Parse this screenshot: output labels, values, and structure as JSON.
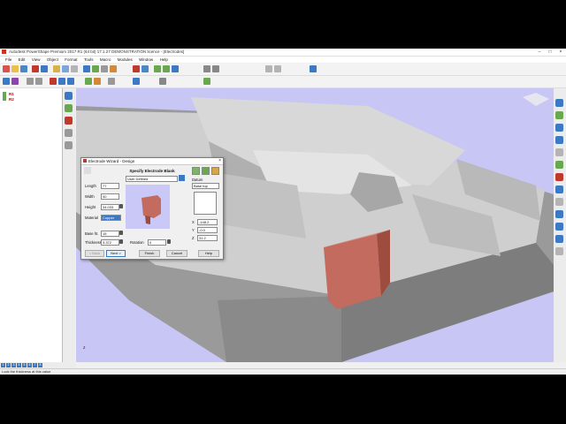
{
  "app": {
    "title": "Autodesk PowerShape Premium 2017 R1 (64 bit) 17.1.27 DEMONSTRATION licence - [Electrodes]",
    "window_controls": [
      "–",
      "□",
      "×"
    ]
  },
  "menu": [
    "File",
    "Edit",
    "View",
    "Object",
    "Format",
    "Tools",
    "Macro",
    "Modules",
    "Window",
    "Help"
  ],
  "tree": {
    "items": [
      "R1",
      "R2"
    ]
  },
  "dialog": {
    "title": "Electrode Wizard - Design",
    "close": "×",
    "heading": "Specify Electrode Blank",
    "length_label": "Length",
    "length_value": "77",
    "width_label": "Width",
    "width_value": "40",
    "height_label": "Height",
    "height_value": "34.033",
    "material_label": "Material",
    "material_value": "Copper",
    "base_label": "Base ht.",
    "base_value": "15",
    "thickness_label": "Thickness",
    "thickness_value": "3.372",
    "rotation_label": "Rotation",
    "rotation_value": "0",
    "type_value": "User Defined",
    "datum_label": "Datum",
    "datum_value": "Base top",
    "x_label": "X",
    "x_value": "-148.2",
    "y_label": "Y",
    "y_value": "-0.0",
    "z_label": "Z",
    "z_value": "31.2",
    "back": "< Back",
    "next": "Next >",
    "finish": "Finish",
    "cancel": "Cancel",
    "help": "Help"
  },
  "pages": [
    "1",
    "2",
    "3",
    "4",
    "5",
    "6",
    "7",
    "8"
  ],
  "status": "Lock the thickness at this value",
  "colors": {
    "viewport": "#c7c6f5",
    "electrode": "#c36b5e",
    "model": "#c8c8c8",
    "accent": "#3b79c5"
  }
}
